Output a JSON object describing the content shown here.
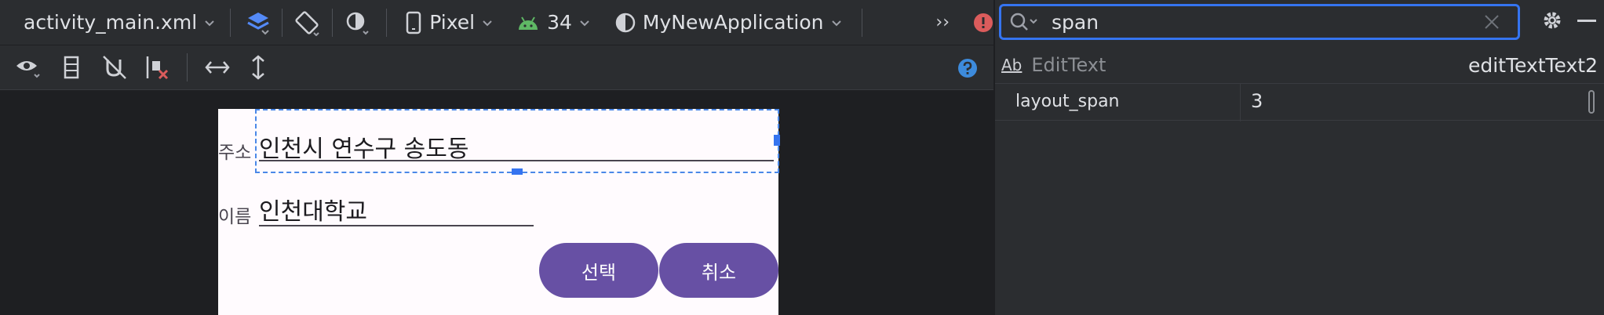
{
  "toolbar": {
    "file_name": "activity_main.xml",
    "device": "Pixel",
    "api_level": "34",
    "theme": "MyNewApplication",
    "more_glyph": "››"
  },
  "design": {
    "address_label": "주소",
    "address_value": "인천시 연수구 송도동",
    "name_label": "이름",
    "name_value": "인천대학교",
    "select_button": "선택",
    "cancel_button": "취소"
  },
  "attributes": {
    "search_value": "span",
    "component_badge": "Ab",
    "component_type": "EditText",
    "component_id": "editTextText2",
    "rows": [
      {
        "name": "layout_span",
        "value": "3"
      }
    ]
  },
  "colors": {
    "accent": "#3574f0",
    "button": "#6750a4",
    "error": "#db5c5c",
    "android": "#5fb865"
  }
}
